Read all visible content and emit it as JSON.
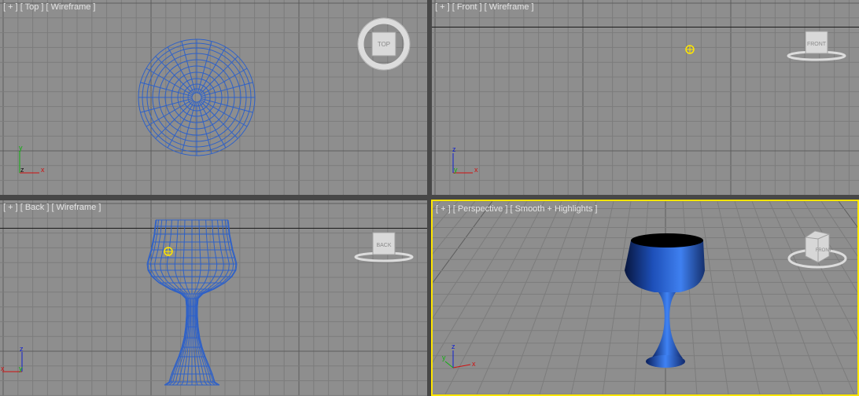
{
  "viewports": {
    "top": {
      "label": "[ + ] [ Top ] [ Wireframe ]",
      "cube_label": "TOP"
    },
    "front": {
      "label": "[ + ] [ Front ] [ Wireframe ]",
      "cube_label": "FRONT"
    },
    "back": {
      "label": "[ + ] [ Back ] [ Wireframe ]",
      "cube_label": "BACK"
    },
    "persp": {
      "label": "[ + ] [ Perspective ] [ Smooth + Highlights ]",
      "cube_label": "FRONT"
    }
  },
  "axes": {
    "x": "x",
    "y": "y",
    "z": "z"
  },
  "colors": {
    "viewport_bg": "#8e8e8e",
    "grid_minor": "#7c7c7c",
    "grid_major": "#5d5d5d",
    "wireframe": "#2e61c8",
    "active_border": "#ffe600",
    "pivot": "#ffe600",
    "axis_x": "#d01010",
    "axis_y": "#10b010",
    "axis_z": "#1020d0"
  }
}
